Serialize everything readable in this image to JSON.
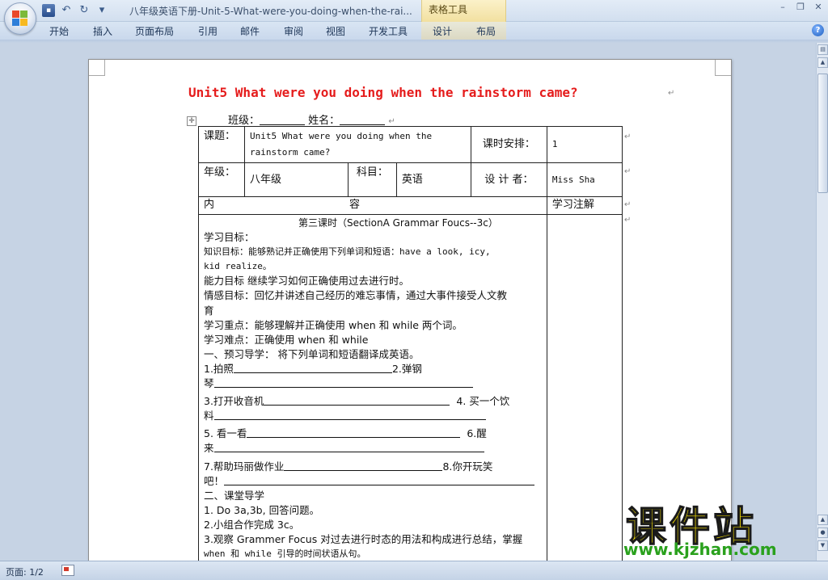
{
  "window": {
    "title": "八年级英语下册-Unit-5-What-were-you-doing-when-the-rai...",
    "context_tool": "表格工具",
    "controls": {
      "minimize": "–",
      "restore": "❐",
      "close": "✕"
    }
  },
  "qat": {
    "save": "save-icon",
    "undo": "↶",
    "redo": "↻",
    "customize": "▾"
  },
  "ribbon": {
    "tabs": [
      "开始",
      "插入",
      "页面布局",
      "引用",
      "邮件",
      "审阅",
      "视图",
      "开发工具",
      "设计",
      "布局"
    ],
    "help": "?"
  },
  "document": {
    "heading": "Unit5 What were you doing when the rainstorm came?",
    "class_label": "班级：",
    "name_label": "姓名：",
    "table": {
      "topic_label": "课题：",
      "topic_value": "Unit5 What were you doing when the rainstorm came?",
      "schedule_label": "课时安排：",
      "schedule_value": "1",
      "grade_label": "年级：",
      "grade_value": "八年级",
      "subject_label": "科目：",
      "subject_value": "英语",
      "designer_label": "设 计 者：",
      "designer_value": "Miss Sha",
      "content_label_left": "内",
      "content_label_right": "容",
      "notes_label": "学习注解",
      "lesson_title": "第三课时（SectionA Grammar Foucs--3c）",
      "lines": [
        "学习目标：",
        "知识目标：能够熟记并正确使用下列单词和短语：have a look, icy,",
        "kid  realize。",
        "能力目标 继续学习如何正确使用过去进行时。",
        "情感目标：回忆并讲述自己经历的难忘事情，通过大事件接受人文教",
        "育",
        "学习重点：能够理解并正确使用 when 和 while 两个词。",
        "学习难点：正确使用 when 和 while",
        "一、预习导学：        将下列单词和短语翻译成英语。",
        "1.拍照",
        "2.弹钢",
        "琴",
        "3.打开收音机",
        "4. 买一个饮",
        "料",
        "5. 看一看",
        "6.醒",
        "来",
        "7.帮助玛丽做作业",
        "8.你开玩笑",
        "吧！",
        "二、课堂导学",
        "1. Do 3a,3b, 回答问题。",
        "2.小组合作完成 3c。",
        "3.观察 Grammer Focus 对过去进行时态的用法和构成进行总结，掌握",
        "when 和 while 引导的时间状语从句。"
      ]
    }
  },
  "status": {
    "page": "页面: 1/2"
  },
  "watermark": {
    "title": "课件站",
    "url": "www.kjzhan.com"
  }
}
